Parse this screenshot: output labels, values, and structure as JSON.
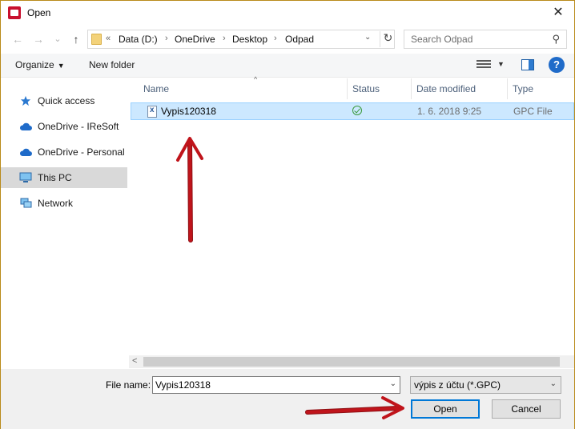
{
  "window": {
    "title": "Open",
    "close_glyph": "✕"
  },
  "nav": {
    "back_glyph": "←",
    "forward_glyph": "→",
    "recent_glyph": "⌄",
    "up_glyph": "↑",
    "overflow": "«",
    "path": [
      "Data (D:)",
      "OneDrive",
      "Desktop",
      "Odpad"
    ],
    "separator": "›",
    "refresh_glyph": "↻",
    "dropdown_glyph": "⌄"
  },
  "search": {
    "placeholder": "Search Odpad",
    "icon": "⚲"
  },
  "toolbar": {
    "organize_label": "Organize",
    "new_folder_label": "New folder",
    "help_glyph": "?"
  },
  "sidebar": {
    "items": [
      {
        "label": "Quick access",
        "icon": "star-icon"
      },
      {
        "label": "OneDrive - IReSoft",
        "icon": "cloud-icon"
      },
      {
        "label": "OneDrive - Personal",
        "icon": "cloud-icon"
      },
      {
        "label": "This PC",
        "icon": "computer-icon",
        "selected": true
      },
      {
        "label": "Network",
        "icon": "network-icon"
      }
    ]
  },
  "filelist": {
    "columns": [
      "Name",
      "Status",
      "Date modified",
      "Type"
    ],
    "sort_glyph": "^",
    "rows": [
      {
        "name": "Vypis120318",
        "status": "synced",
        "date": "1. 6. 2018 9:25",
        "type": "GPC File",
        "selected": true
      }
    ]
  },
  "scroll": {
    "left_glyph": "<"
  },
  "bottom": {
    "filename_label": "File name:",
    "filename_value": "Vypis120318",
    "filter_label": "výpis z účtu (*.GPC)",
    "open_label": "Open",
    "cancel_label": "Cancel",
    "dropdown_glyph": "⌄"
  },
  "colors": {
    "accent": "#0078d7",
    "selection_bg": "#cce8ff",
    "annotation_arrow": "#c0141b"
  }
}
